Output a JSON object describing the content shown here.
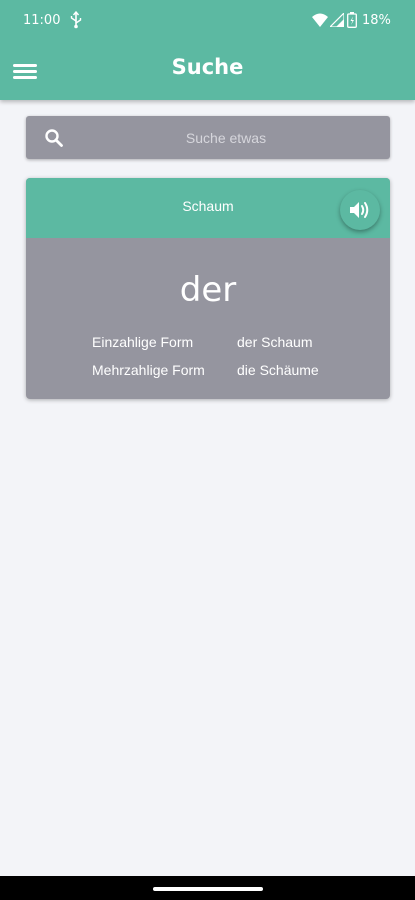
{
  "status_bar": {
    "time": "11:00",
    "battery_percent": "18%",
    "icons": [
      "usb-icon",
      "wifi-icon",
      "signal-icon",
      "battery-icon"
    ]
  },
  "app_bar": {
    "title": "Suche",
    "menu_icon": "hamburger-menu-icon",
    "color": "#5cb9a2"
  },
  "search": {
    "placeholder": "Suche etwas",
    "value": "",
    "icon": "search-icon"
  },
  "result": {
    "word": "Schaum",
    "article": "der",
    "speaker_icon": "speaker-icon",
    "forms": [
      {
        "label": "Einzahlige Form",
        "value": "der Schaum"
      },
      {
        "label": "Mehrzahlige Form",
        "value": "die Schäume"
      }
    ]
  },
  "colors": {
    "accent": "#5cb9a2",
    "card": "#95959f",
    "background": "#f3f4f8"
  }
}
